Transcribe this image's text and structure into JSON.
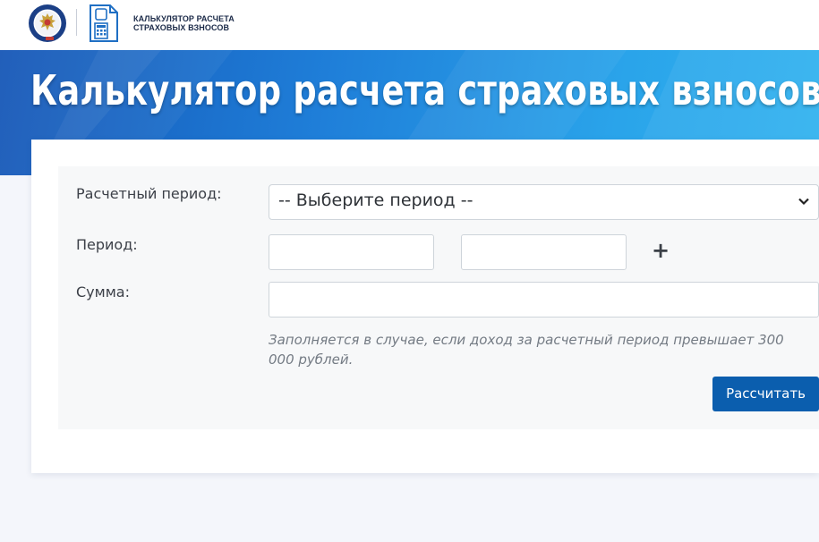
{
  "header": {
    "logo_line1": "Калькулятор расчета",
    "logo_line2": "страховых взносов",
    "emblem_icon": "fns-emblem-icon",
    "calc_icon": "calculator-document-icon"
  },
  "banner": {
    "title": "Калькулятор расчета страховых взносов"
  },
  "form": {
    "period_type_label": "Расчетный период:",
    "period_type_value": "-- Выберите период --",
    "period_label": "Период:",
    "sum_label": "Сумма:",
    "add_icon": "+",
    "hint": "Заполняется в случае, если доход за расчетный период превышает 300 000 рублей.",
    "submit_label": "Рассчитать"
  },
  "colors": {
    "banner_start": "#1556b6",
    "banner_end": "#31b3ef",
    "button": "#0b5eae",
    "page_background": "#f4f6fb"
  }
}
